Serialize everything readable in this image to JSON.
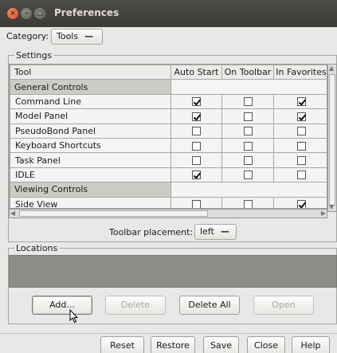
{
  "window": {
    "title": "Preferences"
  },
  "category": {
    "label": "Category:",
    "value": "Tools"
  },
  "settings": {
    "legend": "Settings",
    "columns": [
      "Tool",
      "Auto Start",
      "On Toolbar",
      "In Favorites"
    ],
    "rows": [
      {
        "type": "group",
        "name": "General Controls"
      },
      {
        "type": "tool",
        "name": "Command Line",
        "auto_start": true,
        "on_toolbar": false,
        "in_favorites": true
      },
      {
        "type": "tool",
        "name": "Model Panel",
        "auto_start": true,
        "on_toolbar": false,
        "in_favorites": true
      },
      {
        "type": "tool",
        "name": "PseudoBond Panel",
        "auto_start": false,
        "on_toolbar": false,
        "in_favorites": false
      },
      {
        "type": "tool",
        "name": "Keyboard Shortcuts",
        "auto_start": false,
        "on_toolbar": false,
        "in_favorites": false
      },
      {
        "type": "tool",
        "name": "Task Panel",
        "auto_start": false,
        "on_toolbar": false,
        "in_favorites": false
      },
      {
        "type": "tool",
        "name": "IDLE",
        "auto_start": true,
        "on_toolbar": false,
        "in_favorites": false
      },
      {
        "type": "group",
        "name": "Viewing Controls"
      },
      {
        "type": "tool",
        "name": "Side View",
        "auto_start": false,
        "on_toolbar": false,
        "in_favorites": true
      }
    ]
  },
  "toolbar_placement": {
    "label": "Toolbar placement:",
    "value": "left"
  },
  "locations": {
    "legend": "Locations"
  },
  "location_buttons": {
    "add": "Add...",
    "delete": "Delete",
    "delete_all": "Delete All",
    "open": "Open"
  },
  "footer_buttons": {
    "reset": "Reset",
    "restore": "Restore",
    "save": "Save",
    "close": "Close",
    "help": "Help"
  }
}
